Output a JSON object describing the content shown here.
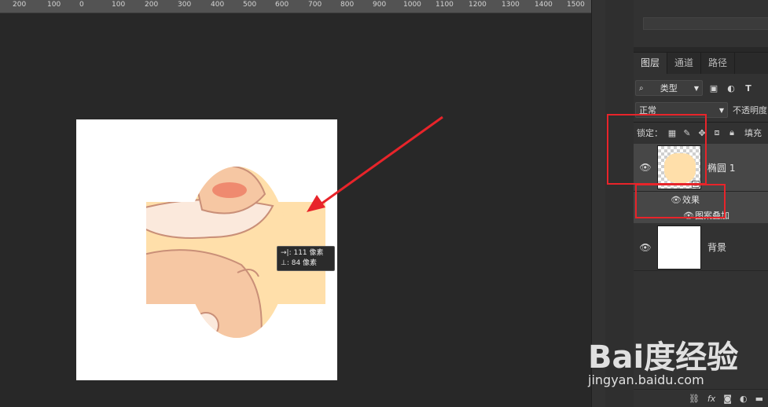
{
  "ruler": {
    "labels": [
      "200",
      "100",
      "0",
      "100",
      "200",
      "300",
      "400",
      "500",
      "600",
      "700",
      "800",
      "900",
      "1000",
      "1100",
      "1200",
      "1300",
      "1400",
      "1500"
    ]
  },
  "tooltip": {
    "width_label": "→|: 111 像素",
    "height_label": "⊥:  84 像素"
  },
  "layers_panel": {
    "tabs": [
      "图层",
      "通道",
      "路径"
    ],
    "filter": {
      "value": "类型",
      "icon": "search-icon"
    },
    "filter_icons": [
      "image-filter-icon",
      "adjustment-filter-icon",
      "type-filter-icon"
    ],
    "blend_mode": "正常",
    "opacity_label": "不透明度",
    "lock_label": "锁定：",
    "fill_label": "填充",
    "layers": [
      {
        "name": "椭圆 1",
        "effects_label": "效果",
        "effect_item": "图案叠加"
      },
      {
        "name": "背景"
      }
    ]
  },
  "colors": {
    "shape_fill": "#ffdfaa",
    "highlight": "#e8242a",
    "selected_layer_bg": "#474747"
  },
  "watermark": {
    "logo": "Bai度经验",
    "url": "jingyan.baidu.com"
  }
}
